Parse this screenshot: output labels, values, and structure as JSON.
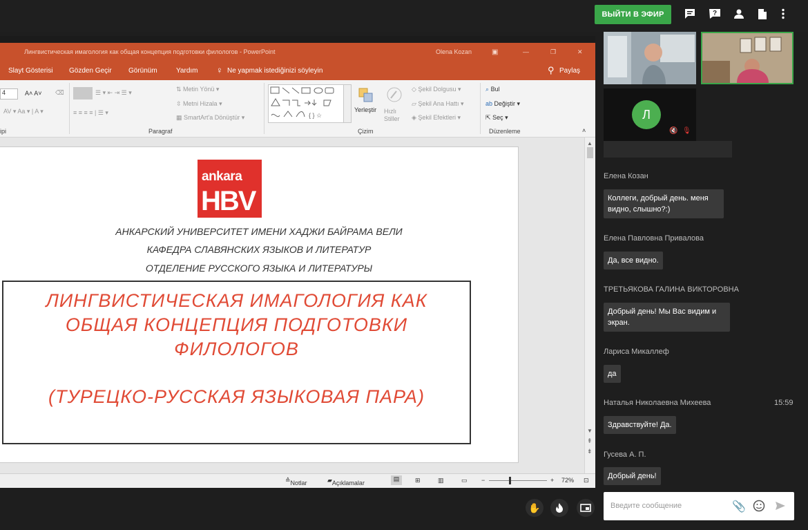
{
  "topbar": {
    "live_button": "ВЫЙТИ В ЭФИР",
    "icons": [
      "chat-icon",
      "help-icon",
      "person-icon",
      "file-icon",
      "more-icon"
    ]
  },
  "powerpoint": {
    "window_title": "Лингвистическая имагология как общая концепция подготовки филологов - PowerPoint",
    "user": "Olena Kozan",
    "menu": [
      "Slayt Gösterisi",
      "Gözden Geçir",
      "Görünüm",
      "Yardım",
      "Ne yapmak istediğinizi söyleyin"
    ],
    "share": "Paylaş",
    "ribbon": {
      "font_size": "4",
      "group_labels": [
        "ipi",
        "Paragraf",
        "Çizim",
        "Düzenleme"
      ],
      "paragraph_items": [
        "Metin Yönü",
        "Metni Hizala",
        "SmartArt'a Dönüştür"
      ],
      "drawing_items": [
        "Yerleştir",
        "Hızlı Stiller",
        "Şekil Dolgusu",
        "Şekil Ana Hattı",
        "Şekil Efektleri"
      ],
      "editing_items": [
        "Bul",
        "Değiştir",
        "Seç"
      ]
    },
    "slide": {
      "logo_top": "ankara",
      "logo_bottom": "HBV",
      "headers": [
        "АНКАРСКИЙ УНИВЕРСИТЕТ ИМЕНИ ХАДЖИ БАЙРАМА ВЕЛИ",
        "КАФЕДРА СЛАВЯНСКИХ ЯЗЫКОВ И ЛИТЕРАТУР",
        "ОТДЕЛЕНИЕ РУССКОГО ЯЗЫКА И ЛИТЕРАТУРЫ"
      ],
      "title_lines": [
        "ЛИНГВИСТИЧЕСКАЯ ИМАГОЛОГИЯ КАК",
        "ОБЩАЯ КОНЦЕПЦИЯ ПОДГОТОВКИ",
        "ФИЛОЛОГОВ",
        "(ТУРЕЦКО-РУССКАЯ ЯЗЫКОВАЯ ПАРА)"
      ]
    },
    "status": {
      "notes": "Notlar",
      "comments": "Açıklamalar",
      "zoom": "72%",
      "zoom_fraction": 0.72
    }
  },
  "participants": {
    "avatar_letter": "Л"
  },
  "chat": {
    "messages": [
      {
        "name": "Елена Козан",
        "time": "",
        "text": "Коллеги, добрый день. меня видно, слышно?:)"
      },
      {
        "name": "Елена Павловна Привалова",
        "time": "",
        "text": "Да, все видно."
      },
      {
        "name": "ТРЕТЬЯКОВА ГАЛИНА ВИКТОРОВНА",
        "time": "",
        "text": "Добрый день! Мы Вас видим и экран."
      },
      {
        "name": "Лариса Микаллеф",
        "time": "",
        "text": "да"
      },
      {
        "name": "Наталья Николаевна Михеева",
        "time": "15:59",
        "text": "Здравствуйте! Да."
      },
      {
        "name": "Гусева А. П.",
        "time": "",
        "text": "Добрый день!"
      }
    ],
    "input_placeholder": "Введите сообщение"
  },
  "colors": {
    "accent_green": "#3aa649",
    "powerpoint_orange": "#c8512c",
    "slide_title_red": "#e04a35",
    "logo_red": "#e0312c"
  }
}
